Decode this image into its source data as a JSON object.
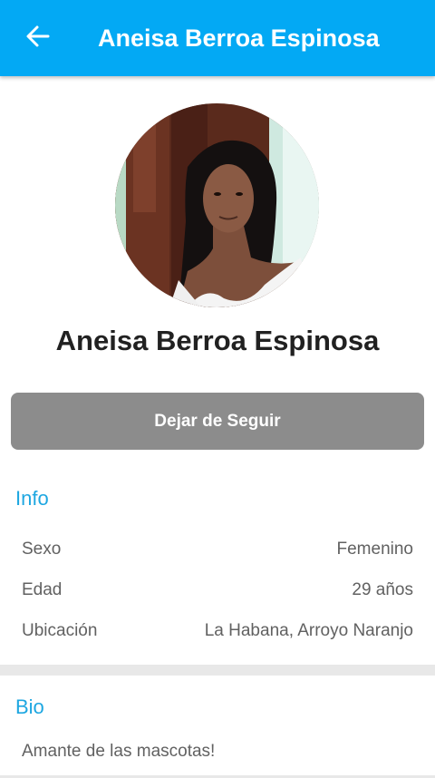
{
  "appbar": {
    "title": "Aneisa Berroa Espinosa",
    "back_icon": "arrow-left-icon",
    "color": "#03A9F4"
  },
  "profile": {
    "name": "Aneisa Berroa Espinosa",
    "follow_button_label": "Dejar de Seguir"
  },
  "info": {
    "title": "Info",
    "rows": [
      {
        "label": "Sexo",
        "value": "Femenino"
      },
      {
        "label": "Edad",
        "value": "29 años"
      },
      {
        "label": "Ubicación",
        "value": "La Habana, Arroyo Naranjo"
      }
    ]
  },
  "bio": {
    "title": "Bio",
    "text": "Amante de las mascotas!"
  },
  "colors": {
    "accent": "#1EA7E1",
    "button": "#8c8c8c",
    "divider": "#e8e8e8"
  }
}
